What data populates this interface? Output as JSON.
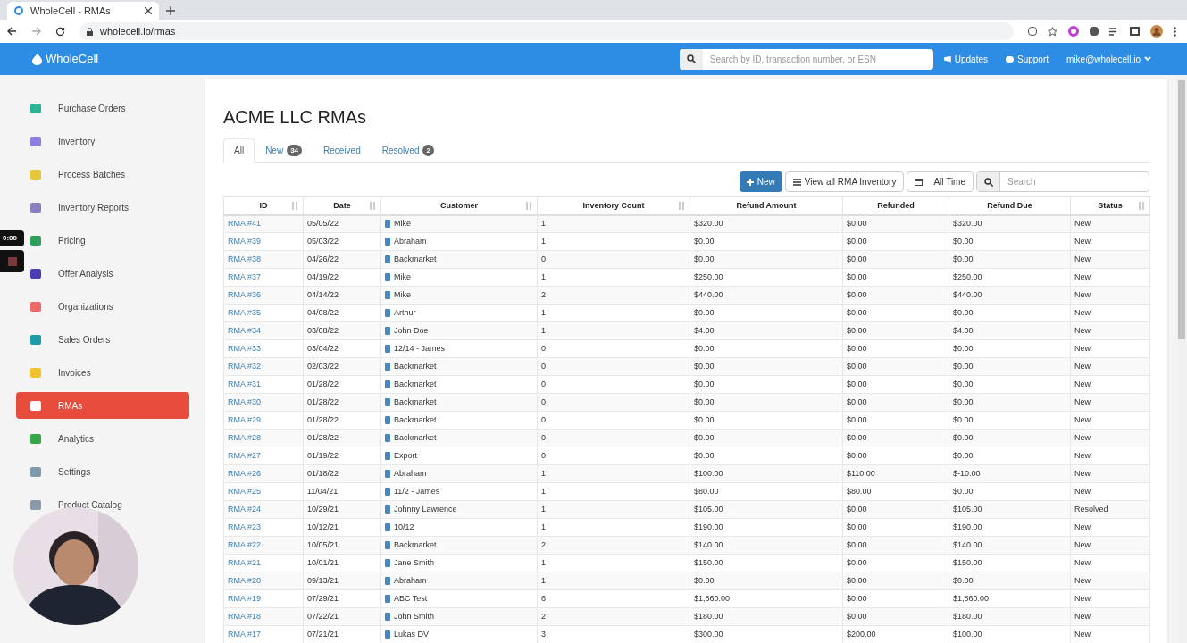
{
  "browser": {
    "tab_title": "WholeCell - RMAs",
    "url": "wholecell.io/rmas"
  },
  "header": {
    "logo": "WholeCell",
    "search_placeholder": "Search by ID, transaction number, or ESN",
    "links": [
      "Updates",
      "Support"
    ],
    "user": "mike@wholecell.io"
  },
  "sidebar": {
    "items": [
      {
        "label": "Purchase Orders",
        "selected": false,
        "color": "#2bb597"
      },
      {
        "label": "Inventory",
        "selected": false,
        "color": "#8a7fe0"
      },
      {
        "label": "Process Batches",
        "selected": false,
        "color": "#e6c63a"
      },
      {
        "label": "Inventory Reports",
        "selected": false,
        "color": "#8a7fc0"
      },
      {
        "label": "Pricing",
        "selected": false,
        "color": "#2f9e5a"
      },
      {
        "label": "Offer Analysis",
        "selected": false,
        "color": "#4a3fb0"
      },
      {
        "label": "Organizations",
        "selected": false,
        "color": "#f06a6a"
      },
      {
        "label": "Sales Orders",
        "selected": false,
        "color": "#1f9aa8"
      },
      {
        "label": "Invoices",
        "selected": false,
        "color": "#f2c12e"
      },
      {
        "label": "RMAs",
        "selected": true,
        "color": "#ffffff"
      },
      {
        "label": "Analytics",
        "selected": false,
        "color": "#3aa64a"
      },
      {
        "label": "Settings",
        "selected": false,
        "color": "#7f9aaa"
      },
      {
        "label": "Product Catalog",
        "selected": false,
        "color": "#8a99a8"
      }
    ]
  },
  "recorder": {
    "timer": "0:00"
  },
  "page": {
    "title": "ACME LLC RMAs",
    "tabs": [
      {
        "label": "All",
        "selected": true
      },
      {
        "label": "New",
        "count": "34",
        "selected": false
      },
      {
        "label": "Received",
        "selected": false
      },
      {
        "label": "Resolved",
        "count": "2",
        "selected": false
      }
    ],
    "toolbar": {
      "new_button": "New",
      "inventory_button": "View all RMA Inventory",
      "range_button": "All Time",
      "search_placeholder": "Search"
    }
  },
  "table": {
    "columns": [
      {
        "label": "ID",
        "sortable": true
      },
      {
        "label": "Date",
        "sortable": true
      },
      {
        "label": "Customer",
        "sortable": true
      },
      {
        "label": "Inventory Count",
        "sortable": true
      },
      {
        "label": "Refund Amount",
        "sortable": false
      },
      {
        "label": "Refunded",
        "sortable": false
      },
      {
        "label": "Refund Due",
        "sortable": false
      },
      {
        "label": "Status",
        "sortable": true
      }
    ],
    "rows": [
      [
        "RMA #41",
        "05/05/22",
        "Mike",
        "1",
        "$320.00",
        "$0.00",
        "$320.00",
        "New"
      ],
      [
        "RMA #39",
        "05/03/22",
        "Abraham",
        "1",
        "$0.00",
        "$0.00",
        "$0.00",
        "New"
      ],
      [
        "RMA #38",
        "04/26/22",
        "Backmarket",
        "0",
        "$0.00",
        "$0.00",
        "$0.00",
        "New"
      ],
      [
        "RMA #37",
        "04/19/22",
        "Mike",
        "1",
        "$250.00",
        "$0.00",
        "$250.00",
        "New"
      ],
      [
        "RMA #36",
        "04/14/22",
        "Mike",
        "2",
        "$440.00",
        "$0.00",
        "$440.00",
        "New"
      ],
      [
        "RMA #35",
        "04/08/22",
        "Arthur",
        "1",
        "$0.00",
        "$0.00",
        "$0.00",
        "New"
      ],
      [
        "RMA #34",
        "03/08/22",
        "John Doe",
        "1",
        "$4.00",
        "$0.00",
        "$4.00",
        "New"
      ],
      [
        "RMA #33",
        "03/04/22",
        "12/14 - James",
        "0",
        "$0.00",
        "$0.00",
        "$0.00",
        "New"
      ],
      [
        "RMA #32",
        "02/03/22",
        "Backmarket",
        "0",
        "$0.00",
        "$0.00",
        "$0.00",
        "New"
      ],
      [
        "RMA #31",
        "01/28/22",
        "Backmarket",
        "0",
        "$0.00",
        "$0.00",
        "$0.00",
        "New"
      ],
      [
        "RMA #30",
        "01/28/22",
        "Backmarket",
        "0",
        "$0.00",
        "$0.00",
        "$0.00",
        "New"
      ],
      [
        "RMA #29",
        "01/28/22",
        "Backmarket",
        "0",
        "$0.00",
        "$0.00",
        "$0.00",
        "New"
      ],
      [
        "RMA #28",
        "01/28/22",
        "Backmarket",
        "0",
        "$0.00",
        "$0.00",
        "$0.00",
        "New"
      ],
      [
        "RMA #27",
        "01/19/22",
        "Export",
        "0",
        "$0.00",
        "$0.00",
        "$0.00",
        "New"
      ],
      [
        "RMA #26",
        "01/18/22",
        "Abraham",
        "1",
        "$100.00",
        "$110.00",
        "$-10.00",
        "New"
      ],
      [
        "RMA #25",
        "11/04/21",
        "11/2 - James",
        "1",
        "$80.00",
        "$80.00",
        "$0.00",
        "New"
      ],
      [
        "RMA #24",
        "10/29/21",
        "Johnny Lawrence",
        "1",
        "$105.00",
        "$0.00",
        "$105.00",
        "Resolved"
      ],
      [
        "RMA #23",
        "10/12/21",
        "10/12",
        "1",
        "$190.00",
        "$0.00",
        "$190.00",
        "New"
      ],
      [
        "RMA #22",
        "10/05/21",
        "Backmarket",
        "2",
        "$140.00",
        "$0.00",
        "$140.00",
        "New"
      ],
      [
        "RMA #21",
        "10/01/21",
        "Jane Smith",
        "1",
        "$150.00",
        "$0.00",
        "$150.00",
        "New"
      ],
      [
        "RMA #20",
        "09/13/21",
        "Abraham",
        "1",
        "$0.00",
        "$0.00",
        "$0.00",
        "New"
      ],
      [
        "RMA #19",
        "07/29/21",
        "ABC Test",
        "6",
        "$1,860.00",
        "$0.00",
        "$1,860.00",
        "New"
      ],
      [
        "RMA #18",
        "07/22/21",
        "John Smith",
        "2",
        "$180.00",
        "$0.00",
        "$180.00",
        "New"
      ],
      [
        "RMA #17",
        "07/21/21",
        "Lukas DV",
        "3",
        "$300.00",
        "$200.00",
        "$100.00",
        "New"
      ]
    ]
  }
}
